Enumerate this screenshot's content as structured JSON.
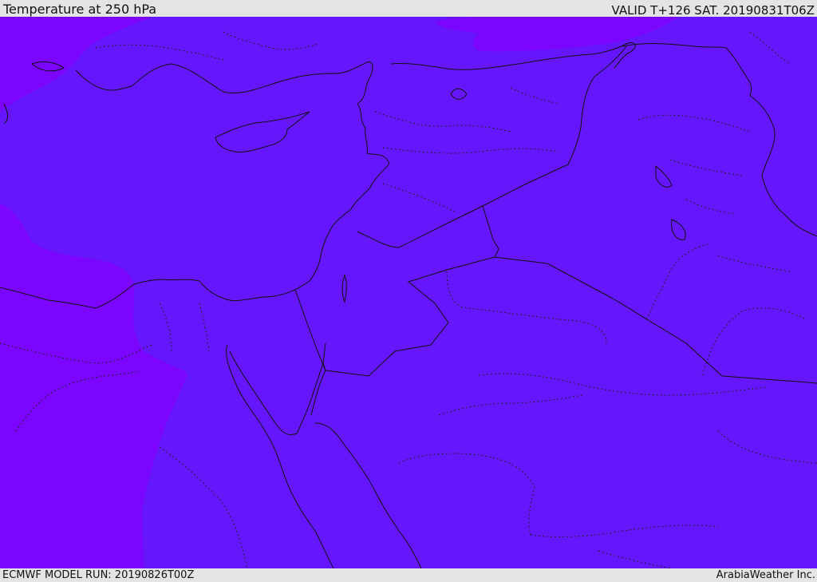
{
  "header": {
    "title": "Temperature at 250 hPa",
    "valid": "VALID T+126 SAT. 20190831T06Z"
  },
  "footer": {
    "model_run": "ECMWF MODEL RUN: 20190826T00Z",
    "brand": "ArabiaWeather Inc."
  },
  "colors": {
    "base_fill": "#6616fb",
    "cold_fill": "#7c06fd",
    "coastline": "#111111",
    "border": "#111111"
  }
}
